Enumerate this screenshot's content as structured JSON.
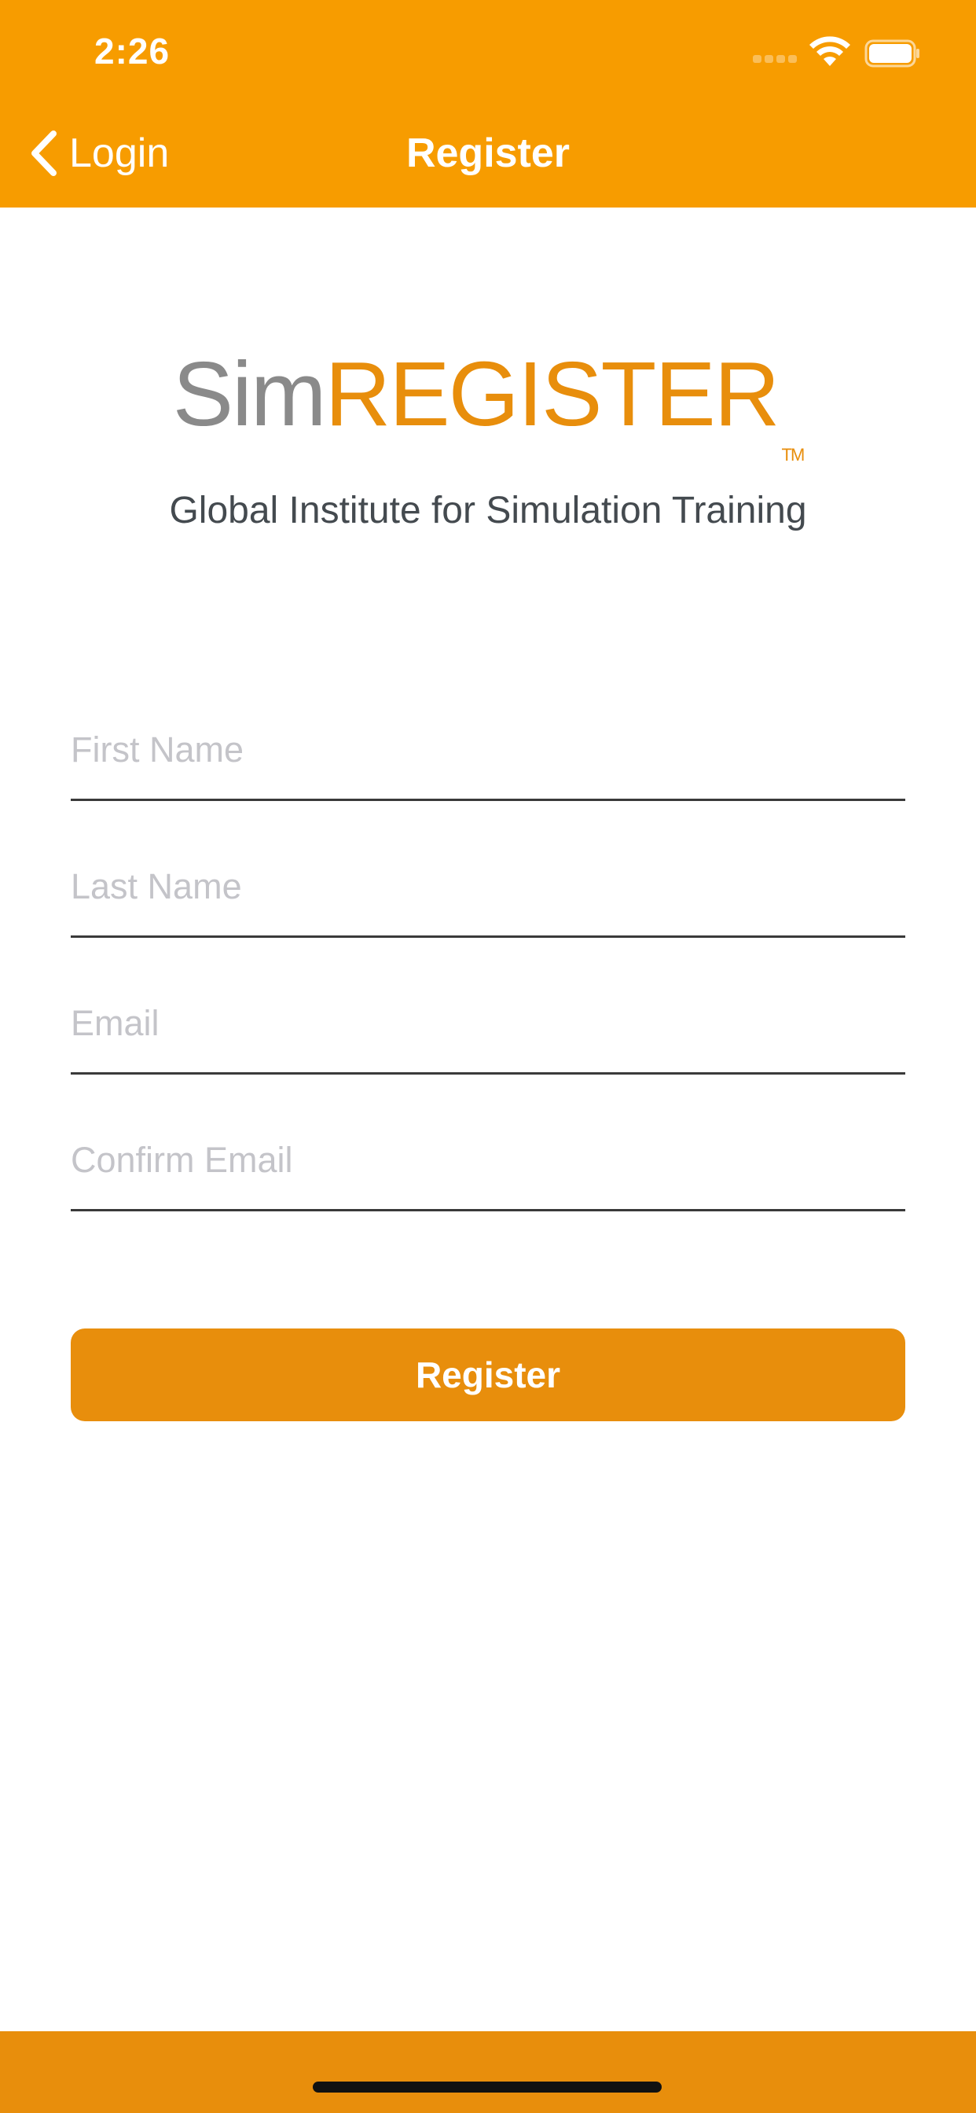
{
  "status_bar": {
    "time": "2:26"
  },
  "nav": {
    "back_label": "Login",
    "title": "Register"
  },
  "brand": {
    "logo_prefix": "Sim",
    "logo_main": "REGISTER",
    "logo_tm": "TM",
    "subtitle": "Global Institute for Simulation Training"
  },
  "form": {
    "first_name_placeholder": "First Name",
    "last_name_placeholder": "Last Name",
    "email_placeholder": "Email",
    "confirm_email_placeholder": "Confirm Email",
    "submit_label": "Register"
  },
  "colors": {
    "header": "#F79C00",
    "accent": "#E88E0C"
  }
}
